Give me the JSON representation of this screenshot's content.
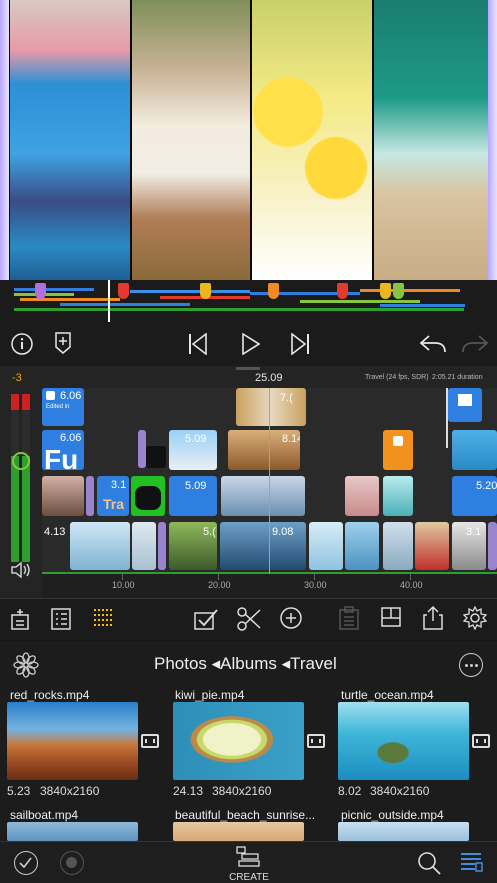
{
  "colors": {
    "accent": "#f5a300",
    "marker_purple": "#b070d8",
    "marker_red": "#e23a2f",
    "marker_orange": "#f08a24",
    "marker_yellow": "#e8b81c",
    "marker_green": "#86c441",
    "clip_blue": "#2f7fe0",
    "clip_orange": "#f2921e",
    "clip_purple": "#9b84cf",
    "audio_green": "#2e9f2e",
    "timeline_bg": "#242424",
    "selected_tool": "#f5c000"
  },
  "transport": {
    "info_icon": "info-circle-icon",
    "marker_icon": "add-marker-icon",
    "prev_icon": "skip-back-icon",
    "play_icon": "play-icon",
    "next_icon": "skip-forward-icon",
    "undo_icon": "undo-icon",
    "redo_icon": "redo-icon"
  },
  "timeline": {
    "level_label": "-3",
    "timecode": "25.09",
    "project_info": "Travel (24 fps, SDR)",
    "duration": "2:05.21 duration",
    "ruler": [
      "10.00",
      "20.00",
      "30.00",
      "40.00"
    ],
    "clips": {
      "title1": "6.06",
      "title1_caption": "Edited in",
      "title2": "6.06",
      "title2_text": "Fu",
      "c509a": "5.09",
      "c814": "8.14",
      "c31": "3.1",
      "c31_text": "Tra",
      "c509b": "5.09",
      "c520": "5.20",
      "c413": "4.13",
      "c5": "5.(",
      "c908": "9.08",
      "c31b": "3.1",
      "c7": "7.("
    }
  },
  "toolbar": {
    "items": [
      "add-clip-icon",
      "inspector-list-icon",
      "timeline-view-icon",
      "select-check-icon",
      "scissors-icon",
      "add-circle-icon",
      "clipboard-icon",
      "layout-icon",
      "share-icon",
      "settings-gear-icon"
    ]
  },
  "browser": {
    "breadcrumb": "Photos ◂Albums ◂Travel",
    "more_icon": "more-ellipsis-icon",
    "photos_icon": "photos-flower-icon",
    "items": [
      {
        "name": "red_rocks.mp4",
        "duration": "5.23",
        "resolution": "3840x2160"
      },
      {
        "name": "kiwi_pie.mp4",
        "duration": "24.13",
        "resolution": "3840x2160"
      },
      {
        "name": "turtle_ocean.mp4",
        "duration": "8.02",
        "resolution": "3840x2160"
      },
      {
        "name": "sailboat.mp4",
        "duration": "",
        "resolution": ""
      },
      {
        "name": "beautiful_beach_sunrise...",
        "duration": "",
        "resolution": ""
      },
      {
        "name": "picnic_outside.mp4",
        "duration": "",
        "resolution": ""
      }
    ]
  },
  "bottom": {
    "create_label": "CREATE"
  }
}
